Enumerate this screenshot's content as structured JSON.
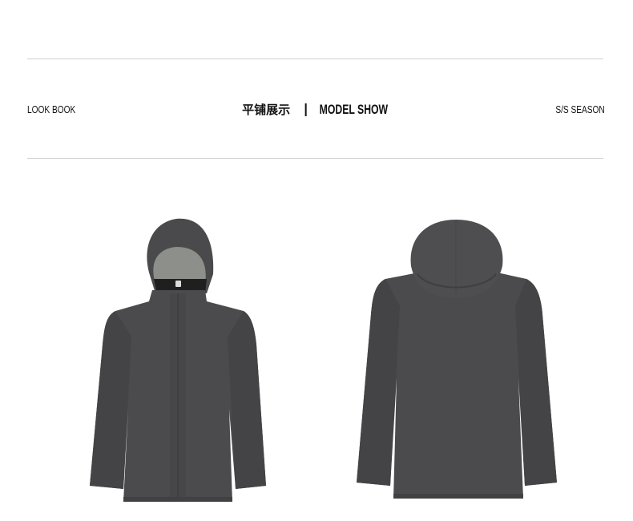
{
  "header": {
    "left_label": "LOOK BOOK",
    "center_cn": "平铺展示",
    "center_en": "MODEL SHOW",
    "right_label": "S/S SEASON"
  },
  "products": [
    {
      "view": "front",
      "color": "#4b4b4d"
    },
    {
      "view": "back",
      "color": "#4b4b4d"
    }
  ],
  "colors": {
    "jacket": "#4b4b4d",
    "jacket_shade": "#3e3e40",
    "hood_lining": "#8d8f8a",
    "rule": "#cfcfcf"
  }
}
